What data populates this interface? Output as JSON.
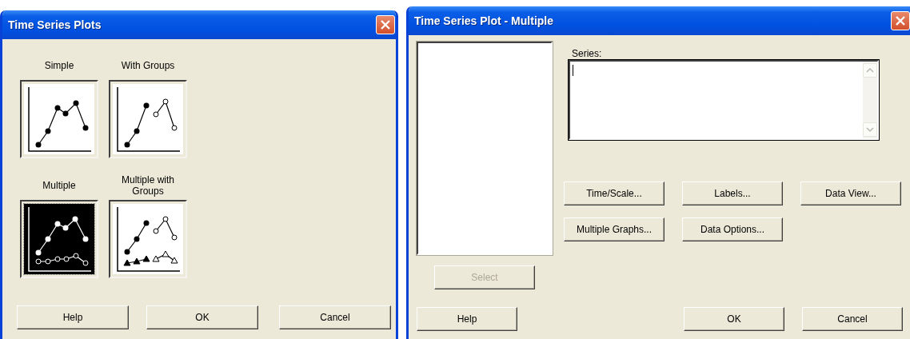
{
  "dialogs": [
    {
      "title": "Time Series Plots",
      "kind": "gallery",
      "plot_types": [
        {
          "label": "Simple",
          "kind": "simple",
          "selected": false
        },
        {
          "label": "With Groups",
          "kind": "groups",
          "selected": false
        },
        {
          "label": "Multiple",
          "kind": "multiple",
          "selected": true
        },
        {
          "label": "Multiple with Groups",
          "kind": "multiple_groups",
          "selected": false
        }
      ],
      "buttons": [
        {
          "label": "Help"
        },
        {
          "label": "OK"
        },
        {
          "label": "Cancel"
        }
      ]
    },
    {
      "title": "Time Series Plot - Multiple",
      "kind": "form",
      "series": {
        "label": "Series:"
      },
      "option_buttons": [
        {
          "label": "Time/Scale..."
        },
        {
          "label": "Labels..."
        },
        {
          "label": "Data View..."
        },
        {
          "label": "Multiple Graphs..."
        },
        {
          "label": "Data Options..."
        }
      ],
      "select_button": {
        "label": "Select",
        "disabled": true
      },
      "buttons": [
        {
          "label": "Help"
        },
        {
          "label": "OK"
        },
        {
          "label": "Cancel"
        }
      ]
    }
  ]
}
